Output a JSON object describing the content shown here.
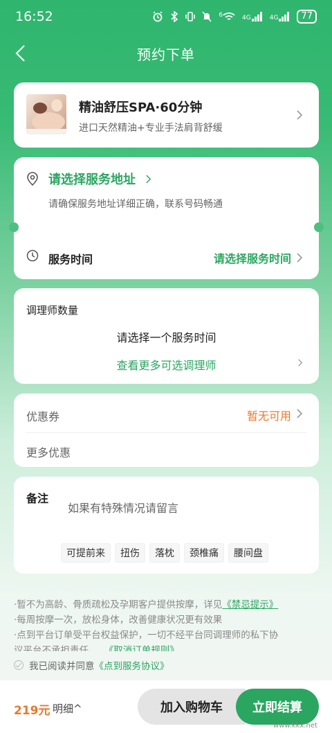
{
  "status_bar": {
    "time": "16:52",
    "battery": "77",
    "signal_1": "4G",
    "signal_2": "4G",
    "wifi_badge": "6"
  },
  "nav": {
    "title": "预约下单"
  },
  "service": {
    "name": "精油舒压SPA·60分钟",
    "desc": "进口天然精油+专业手法肩背舒缓"
  },
  "address": {
    "title": "请选择服务地址",
    "desc": "请确保服务地址详细正确，联系号码畅通"
  },
  "time": {
    "label": "服务时间",
    "value": "请选择服务时间"
  },
  "therapist": {
    "label": "调理师数量",
    "hint": "请选择一个服务时间",
    "more": "查看更多可选调理师"
  },
  "coupon": {
    "label": "优惠券",
    "value": "暂无可用",
    "more_label": "更多优惠"
  },
  "remark": {
    "label": "备注",
    "placeholder": "如果有特殊情况请留言",
    "tags": [
      "可提前来",
      "扭伤",
      "落枕",
      "颈椎痛",
      "腰间盘"
    ]
  },
  "notes": {
    "line1": "·暂不为高龄、骨质疏松及孕期客户提供按摩，详见",
    "line1_link": "《禁忌提示》",
    "line2": "·每周按摩一次，放松身体，改善健康状况更有效果",
    "line3": "·点到平台订单受平台权益保护，一切不经平台同调理师的私下协",
    "line4": "议平台不承担责任。",
    "line4_link": "《取消订单规则》"
  },
  "agreement": {
    "text": "我已阅读并同意",
    "link": "《点到服务协议》"
  },
  "bottom": {
    "price": "219元",
    "detail": "明细^",
    "cart_label": "加入购物车",
    "pay_label": "立即结算"
  },
  "watermark": "www.kkx.net",
  "colors": {
    "brand_green": "#2aa660",
    "header_green": "#2fb56e",
    "orange": "#e8792d"
  }
}
